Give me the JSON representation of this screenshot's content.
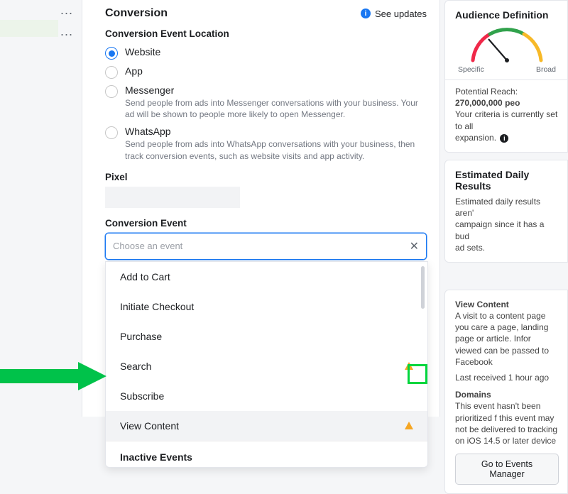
{
  "left": {
    "row1": "...",
    "row2": "..."
  },
  "main": {
    "title": "Conversion",
    "see_updates": "See updates",
    "cel_heading": "Conversion Event Location",
    "radios": [
      {
        "label": "Website",
        "desc": "",
        "checked": true
      },
      {
        "label": "App",
        "desc": "",
        "checked": false
      },
      {
        "label": "Messenger",
        "desc": "Send people from ads into Messenger conversations with your business. Your ad will be shown to people more likely to open Messenger.",
        "checked": false
      },
      {
        "label": "WhatsApp",
        "desc": "Send people from ads into WhatsApp conversations with your business, then track conversion events, such as website visits and app activity.",
        "checked": false
      }
    ],
    "pixel_heading": "Pixel",
    "ce_heading": "Conversion Event",
    "ce_placeholder": "Choose an event",
    "events": [
      {
        "label": "Add to Cart",
        "warn": false
      },
      {
        "label": "Initiate Checkout",
        "warn": false
      },
      {
        "label": "Purchase",
        "warn": false
      },
      {
        "label": "Search",
        "warn": true
      },
      {
        "label": "Subscribe",
        "warn": false
      },
      {
        "label": "View Content",
        "warn": true,
        "hovered": true
      }
    ],
    "inactive_heading": "Inactive Events"
  },
  "right": {
    "aud_title": "Audience Definition",
    "specific": "Specific",
    "broad": "Broad",
    "reach_label": "Potential Reach:",
    "reach_value": "270,000,000 peo",
    "criteria": "Your criteria is currently set to all",
    "criteria2": "expansion.",
    "edr_title": "Estimated Daily Results",
    "edr_body1": "Estimated daily results aren'",
    "edr_body2": "campaign since it has a bud",
    "edr_body3": "ad sets.",
    "vc_title": "View Content",
    "vc_body": "A visit to a content page you care a page, landing page or article. Infor viewed can be passed to Facebook",
    "vc_last": "Last received 1 hour ago",
    "dom_title": "Domains",
    "dom_body": "This event hasn't been prioritized f this event may not be delivered to tracking on iOS 14.5 or later device",
    "btn": "Go to Events Manager"
  }
}
